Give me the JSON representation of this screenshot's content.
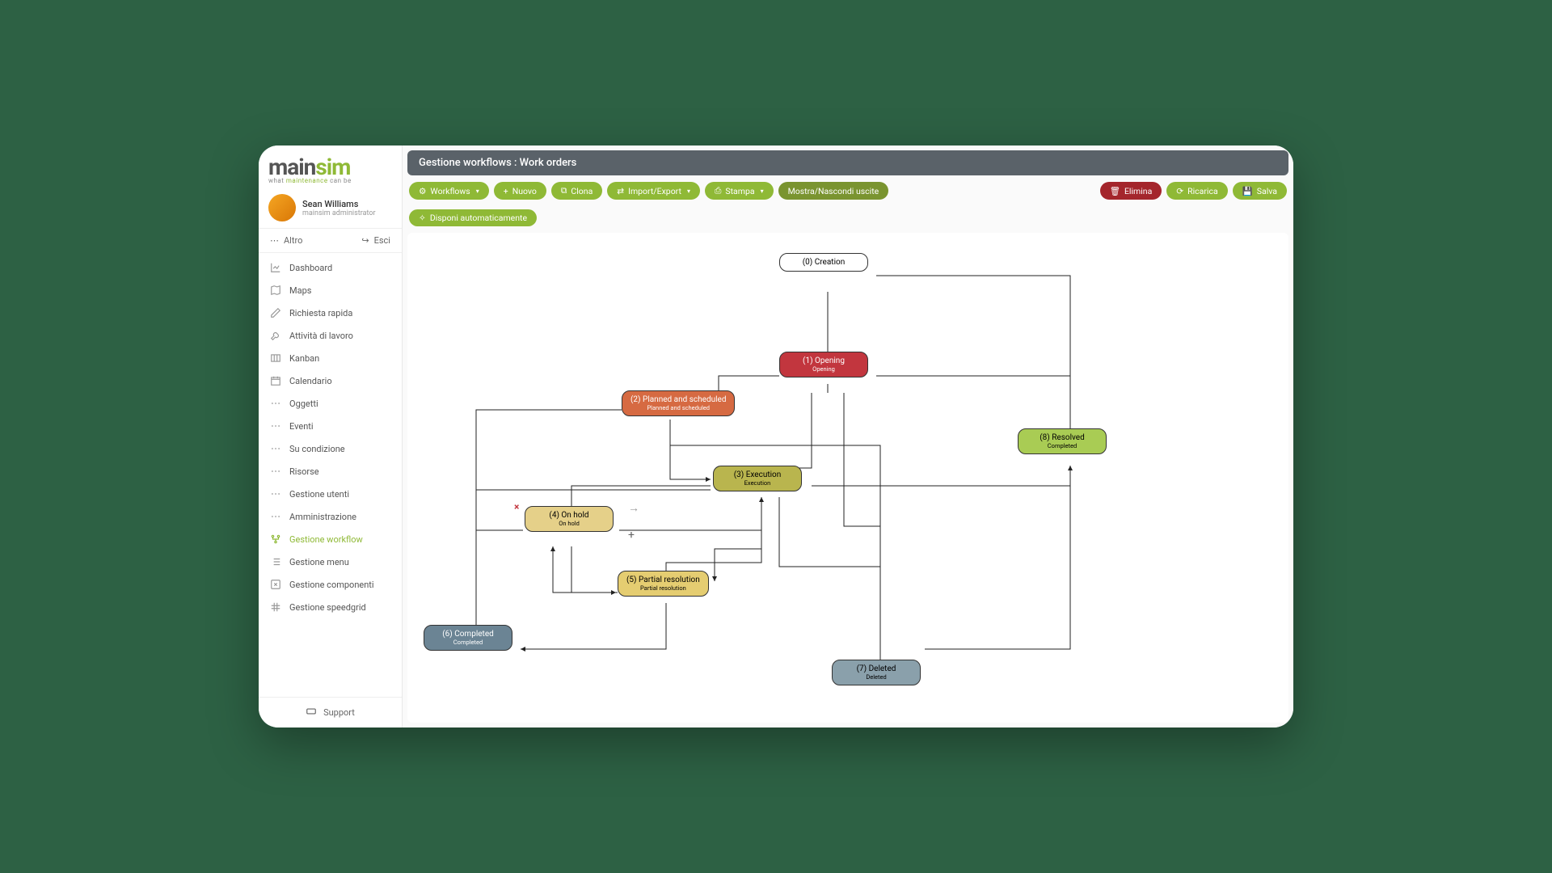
{
  "logo": {
    "part1": "main",
    "part2": "sim",
    "sub_pre": "what ",
    "sub_hl": "maintenance",
    "sub_post": " can be"
  },
  "user": {
    "name": "Sean Williams",
    "role": "mainsim administrator"
  },
  "top_actions": {
    "more": "Altro",
    "exit": "Esci"
  },
  "nav": [
    {
      "label": "Dashboard",
      "icon": "chart"
    },
    {
      "label": "Maps",
      "icon": "map"
    },
    {
      "label": "Richiesta rapida",
      "icon": "pencil"
    },
    {
      "label": "Attività di lavoro",
      "icon": "wrench"
    },
    {
      "label": "Kanban",
      "icon": "board"
    },
    {
      "label": "Calendario",
      "icon": "calendar"
    },
    {
      "label": "Oggetti",
      "icon": "dots"
    },
    {
      "label": "Eventi",
      "icon": "dots"
    },
    {
      "label": "Su condizione",
      "icon": "dots"
    },
    {
      "label": "Risorse",
      "icon": "dots"
    },
    {
      "label": "Gestione utenti",
      "icon": "dots"
    },
    {
      "label": "Amministrazione",
      "icon": "dots"
    },
    {
      "label": "Gestione workflow",
      "icon": "flow",
      "active": true
    },
    {
      "label": "Gestione menu",
      "icon": "list"
    },
    {
      "label": "Gestione componenti",
      "icon": "edit"
    },
    {
      "label": "Gestione speedgrid",
      "icon": "grid"
    }
  ],
  "support": "Support",
  "title": "Gestione workflows : Work orders",
  "toolbar": {
    "workflows": "Workflows",
    "nuovo": "Nuovo",
    "clona": "Clona",
    "import_export": "Import/Export",
    "stampa": "Stampa",
    "mostra": "Mostra/Nascondi uscite",
    "disponi": "Disponi automaticamente",
    "elimina": "Elimina",
    "ricarica": "Ricarica",
    "salva": "Salva"
  },
  "nodes": {
    "n0": {
      "title": "(0) Creation",
      "sub": ""
    },
    "n1": {
      "title": "(1) Opening",
      "sub": "Opening"
    },
    "n2": {
      "title": "(2) Planned and scheduled",
      "sub": "Planned and scheduled"
    },
    "n3": {
      "title": "(3) Execution",
      "sub": "Execution"
    },
    "n4": {
      "title": "(4) On hold",
      "sub": "On hold"
    },
    "n5": {
      "title": "(5) Partial resolution",
      "sub": "Partial resolution"
    },
    "n6": {
      "title": "(6) Completed",
      "sub": "Completed"
    },
    "n7": {
      "title": "(7) Deleted",
      "sub": "Deleted"
    },
    "n8": {
      "title": "(8) Resolved",
      "sub": "Completed"
    }
  }
}
